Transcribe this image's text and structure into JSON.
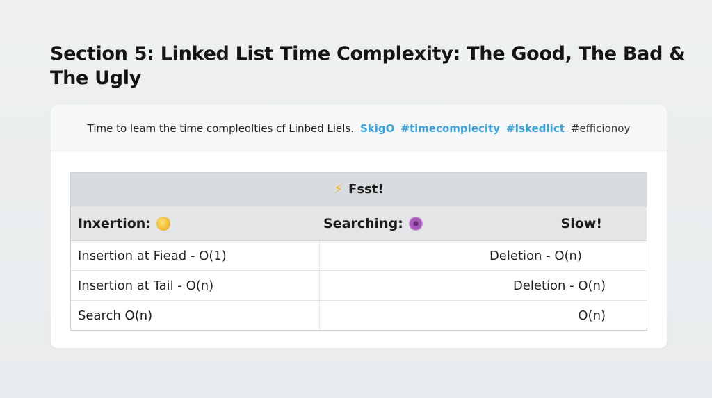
{
  "title": "Section 5: Linked List Time Complexity: The Good, The Bad & The Ugly",
  "header": {
    "description": "Time to leam the time compleolties cf Linbed Liels.",
    "tags": [
      {
        "text": "SkigO",
        "color": "#3aa3d8"
      },
      {
        "text": "#timecomplecity",
        "color": "#3aa3d8"
      },
      {
        "text": "#Iskedlict",
        "color": "#3aa3d8"
      },
      {
        "text": "#efficionoy",
        "color": "#333333"
      }
    ]
  },
  "table": {
    "banner": {
      "icon": "lightning-icon",
      "icon_glyph": "⚡",
      "label": "Fsst!"
    },
    "columns": [
      {
        "label": "Inxertion:",
        "icon": "grimace-emoji-icon"
      },
      {
        "label": "Searching:",
        "icon": "purple-circle-emoji-icon"
      },
      {
        "label": "Slow!"
      }
    ],
    "rows": [
      {
        "left": "Insertion at Fiead - O(1)",
        "right": "Deletion - O(n)"
      },
      {
        "left": "Insertion at Tail - O(n)",
        "right": "Deletion - O(n)"
      },
      {
        "left": "Search O(n)",
        "right": "O(n)"
      }
    ]
  }
}
